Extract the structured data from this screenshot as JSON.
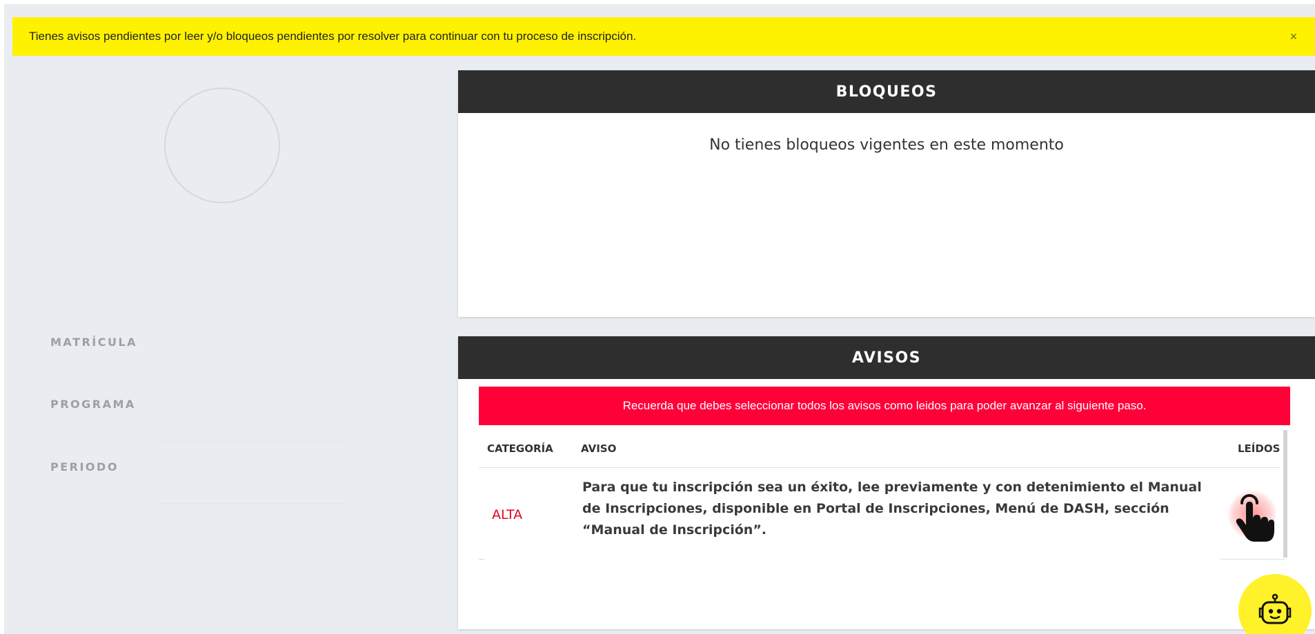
{
  "alert": {
    "message": "Tienes avisos pendientes por leer y/o bloqueos pendientes por resolver para continuar con tu proceso de inscripción.",
    "close_label": "×"
  },
  "profile": {
    "avatar_icon": "avatar-placeholder",
    "labels": {
      "matricula": "MATRÍCULA",
      "programa": "PROGRAMA",
      "periodo": "PERIODO"
    }
  },
  "bloqueos": {
    "title": "BLOQUEOS",
    "empty_message": "No tienes bloqueos vigentes en este momento"
  },
  "avisos": {
    "title": "AVISOS",
    "warning": "Recuerda que debes seleccionar todos los avisos como leidos para poder avanzar al siguiente paso.",
    "columns": {
      "category": "CATEGORÍA",
      "notice": "AVISO",
      "read": "LEÍDOS"
    },
    "rows": [
      {
        "category": "ALTA",
        "notice": "Para que tu inscripción sea un éxito, lee previamente y con detenimiento el Manual de Inscripciones, disponible en Portal de Inscripciones, Menú de DASH, sección “Manual de Inscripción”.",
        "read_icon": "tap-hand-icon"
      }
    ]
  },
  "assistant": {
    "icon": "robot-icon"
  },
  "colors": {
    "alert_bg": "#fff200",
    "header_bg": "#2e2e2e",
    "warning_bg": "#ff0039",
    "category_alta": "#e3001f",
    "assistant_bg": "#fff12a"
  }
}
